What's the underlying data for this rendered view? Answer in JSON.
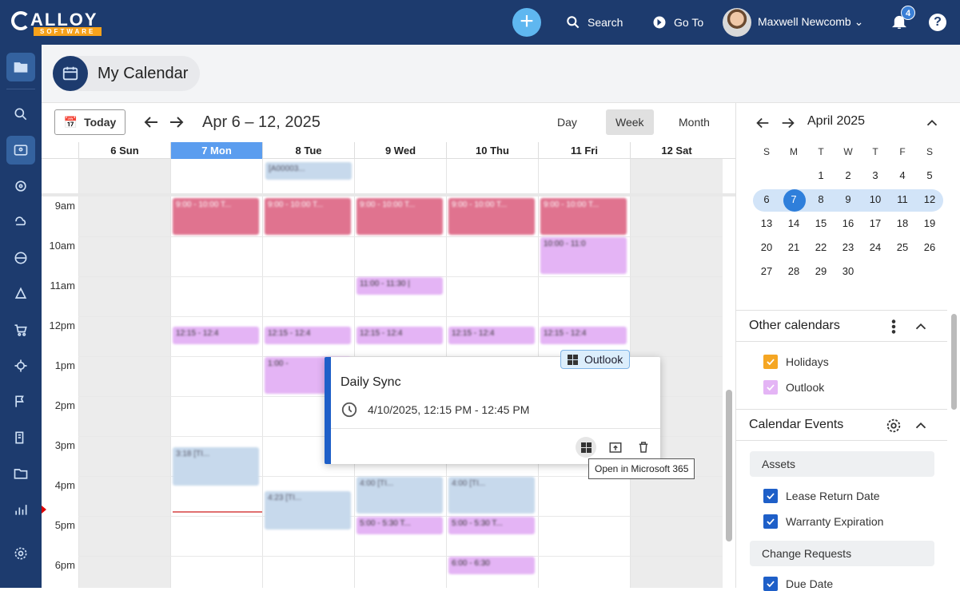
{
  "app": {
    "logo_main": "ALLOY",
    "logo_sub": "SOFTWARE",
    "search_label": "Search",
    "goto_label": "Go To",
    "user_name": "Maxwell Newcomb",
    "notifications": "4",
    "help": "?",
    "plus": "+"
  },
  "page": {
    "title": "My Calendar"
  },
  "toolbar": {
    "today": "Today",
    "range": "Apr 6 – 12, 2025",
    "views": [
      "Day",
      "Week",
      "Month"
    ],
    "active_view": "Week"
  },
  "week": {
    "days": [
      "6 Sun",
      "7 Mon",
      "8 Tue",
      "9 Wed",
      "10 Thu",
      "11 Fri",
      "12 Sat"
    ],
    "today_index": 1,
    "hours": [
      "9am",
      "10am",
      "11am",
      "12pm",
      "1pm",
      "2pm",
      "3pm",
      "4pm",
      "5pm",
      "6pm"
    ]
  },
  "events": {
    "allday_tue": "[A00003...",
    "standup": "9:00 - 10:00 T...",
    "fri_ten": "10:00 - 11:0",
    "wed_eleven": "11:00 - 11:30 |",
    "sync": "12:15 - 12:4",
    "tue_one": "1:00 -",
    "mon_three": "3:18 [TI...",
    "tue_four": "4:23 [TI...",
    "wed_four": "4:00 [TI...",
    "thu_four": "4:00 [TI...",
    "five": "5:00 - 5:30 T...",
    "thu_six": "6:00 - 6:30"
  },
  "popup": {
    "title": "Daily Sync",
    "time": "4/10/2025, 12:15 PM - 12:45 PM",
    "source": "Outlook",
    "tooltip": "Open in Microsoft 365",
    "accent": "#1e5fc8"
  },
  "mini": {
    "title": "April 2025",
    "dow": [
      "S",
      "M",
      "T",
      "W",
      "T",
      "F",
      "S"
    ],
    "weeks": [
      [
        "",
        "",
        "1",
        "2",
        "3",
        "4",
        "5"
      ],
      [
        "6",
        "7",
        "8",
        "9",
        "10",
        "11",
        "12"
      ],
      [
        "13",
        "14",
        "15",
        "16",
        "17",
        "18",
        "19"
      ],
      [
        "20",
        "21",
        "22",
        "23",
        "24",
        "25",
        "26"
      ],
      [
        "27",
        "28",
        "29",
        "30",
        "",
        "",
        ""
      ]
    ],
    "selected": "7"
  },
  "other_calendars": {
    "title": "Other calendars",
    "items": [
      {
        "label": "Holidays",
        "color": "#f5a623"
      },
      {
        "label": "Outlook",
        "color": "#e4b4f5"
      }
    ]
  },
  "calendar_events": {
    "title": "Calendar Events",
    "groups": [
      {
        "label": "Assets",
        "items": [
          "Lease Return Date",
          "Warranty Expiration"
        ]
      },
      {
        "label": "Change Requests",
        "items": [
          "Due Date"
        ]
      }
    ]
  },
  "colors": {
    "nav": "#1d3b6e",
    "today_header": "#5b9def",
    "checkbox": "#1e5fc8"
  }
}
